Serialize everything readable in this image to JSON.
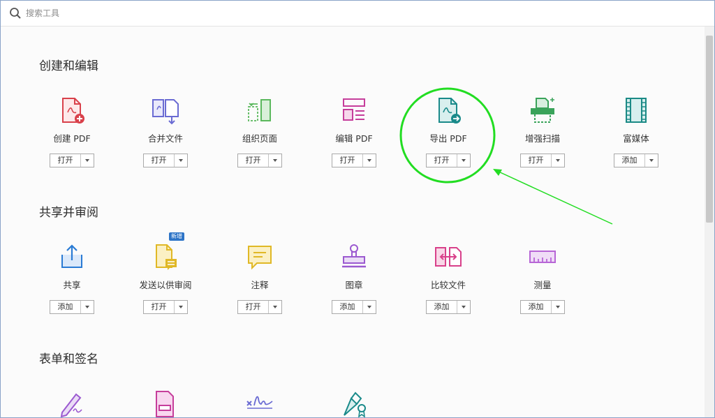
{
  "search": {
    "placeholder": "搜索工具"
  },
  "sections": [
    {
      "title": "创建和编辑",
      "tools": [
        {
          "label": "创建 PDF",
          "button": "打开",
          "icon": "create-pdf-icon"
        },
        {
          "label": "合并文件",
          "button": "打开",
          "icon": "combine-files-icon"
        },
        {
          "label": "组织页面",
          "button": "打开",
          "icon": "organize-pages-icon"
        },
        {
          "label": "编辑 PDF",
          "button": "打开",
          "icon": "edit-pdf-icon"
        },
        {
          "label": "导出 PDF",
          "button": "打开",
          "icon": "export-pdf-icon"
        },
        {
          "label": "增强扫描",
          "button": "打开",
          "icon": "enhance-scan-icon"
        },
        {
          "label": "富媒体",
          "button": "添加",
          "icon": "rich-media-icon"
        }
      ]
    },
    {
      "title": "共享并审阅",
      "tools": [
        {
          "label": "共享",
          "button": "添加",
          "icon": "share-icon"
        },
        {
          "label": "发送以供审阅",
          "button": "打开",
          "icon": "send-for-review-icon",
          "badge": "新增"
        },
        {
          "label": "注释",
          "button": "打开",
          "icon": "comment-icon"
        },
        {
          "label": "图章",
          "button": "添加",
          "icon": "stamp-icon"
        },
        {
          "label": "比较文件",
          "button": "添加",
          "icon": "compare-files-icon"
        },
        {
          "label": "测量",
          "button": "添加",
          "icon": "measure-icon"
        }
      ]
    },
    {
      "title": "表单和签名",
      "tools": [
        {
          "icon": "fill-sign-icon"
        },
        {
          "icon": "prepare-form-icon"
        },
        {
          "icon": "signature-icon"
        },
        {
          "icon": "certificates-icon"
        }
      ]
    }
  ],
  "colors": {
    "annotation": "#22dd22",
    "create": "#d9414b",
    "combine": "#6a6bd3",
    "organize": "#5bb85d",
    "edit": "#c63e9b",
    "export": "#1a8a8a",
    "scan": "#3aa35a",
    "media": "#1b8a86",
    "share": "#2a7bd4",
    "review": "#e0b826",
    "stamp": "#9b59d0",
    "compare": "#d8408a",
    "measure": "#b765d6"
  }
}
